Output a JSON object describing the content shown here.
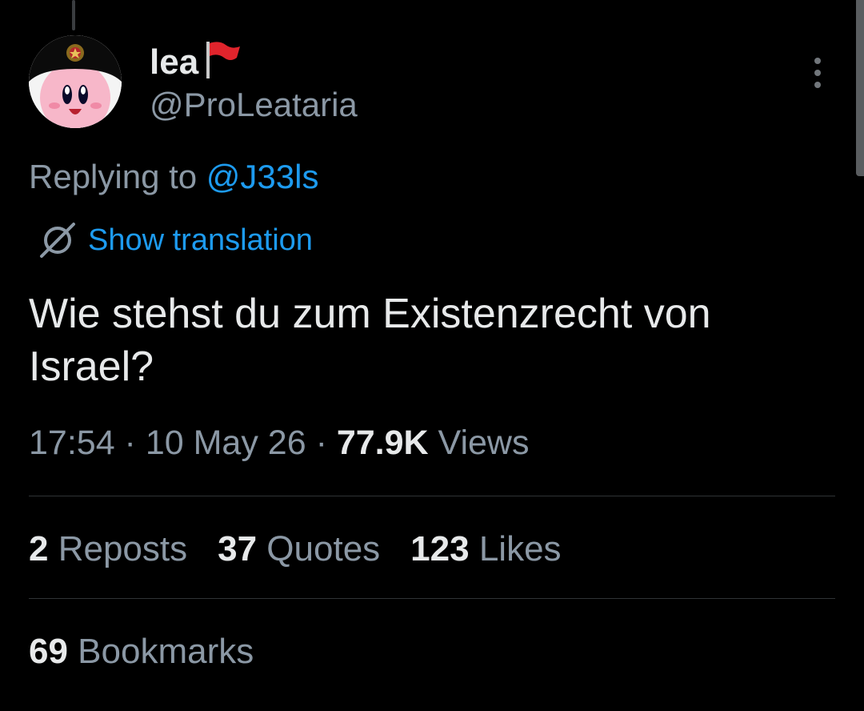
{
  "author": {
    "display_name": "lea",
    "flag_icon": "red-flag-icon",
    "handle": "@ProLeataria"
  },
  "reply": {
    "prefix": "Replying to ",
    "to_handle": "@J33ls"
  },
  "translation": {
    "icon": "globe-icon",
    "label": "Show translation"
  },
  "tweet": {
    "text": "Wie stehst du zum Existenzrecht von Israel?"
  },
  "meta": {
    "time": "17:54",
    "separator1": " · ",
    "date": "10 May 26",
    "separator2": " · ",
    "views_count": "77.9K",
    "views_label": " Views"
  },
  "stats": {
    "reposts_count": "2",
    "reposts_label": " Reposts",
    "quotes_count": "37",
    "quotes_label": " Quotes",
    "likes_count": "123",
    "likes_label": " Likes",
    "bookmarks_count": "69",
    "bookmarks_label": " Bookmarks"
  },
  "colors": {
    "background": "#000000",
    "primary_text": "#e7e9ea",
    "secondary_text": "#8b98a5",
    "accent": "#1d9bf0",
    "divider": "#2f3336",
    "flag_red": "#e0242c"
  }
}
